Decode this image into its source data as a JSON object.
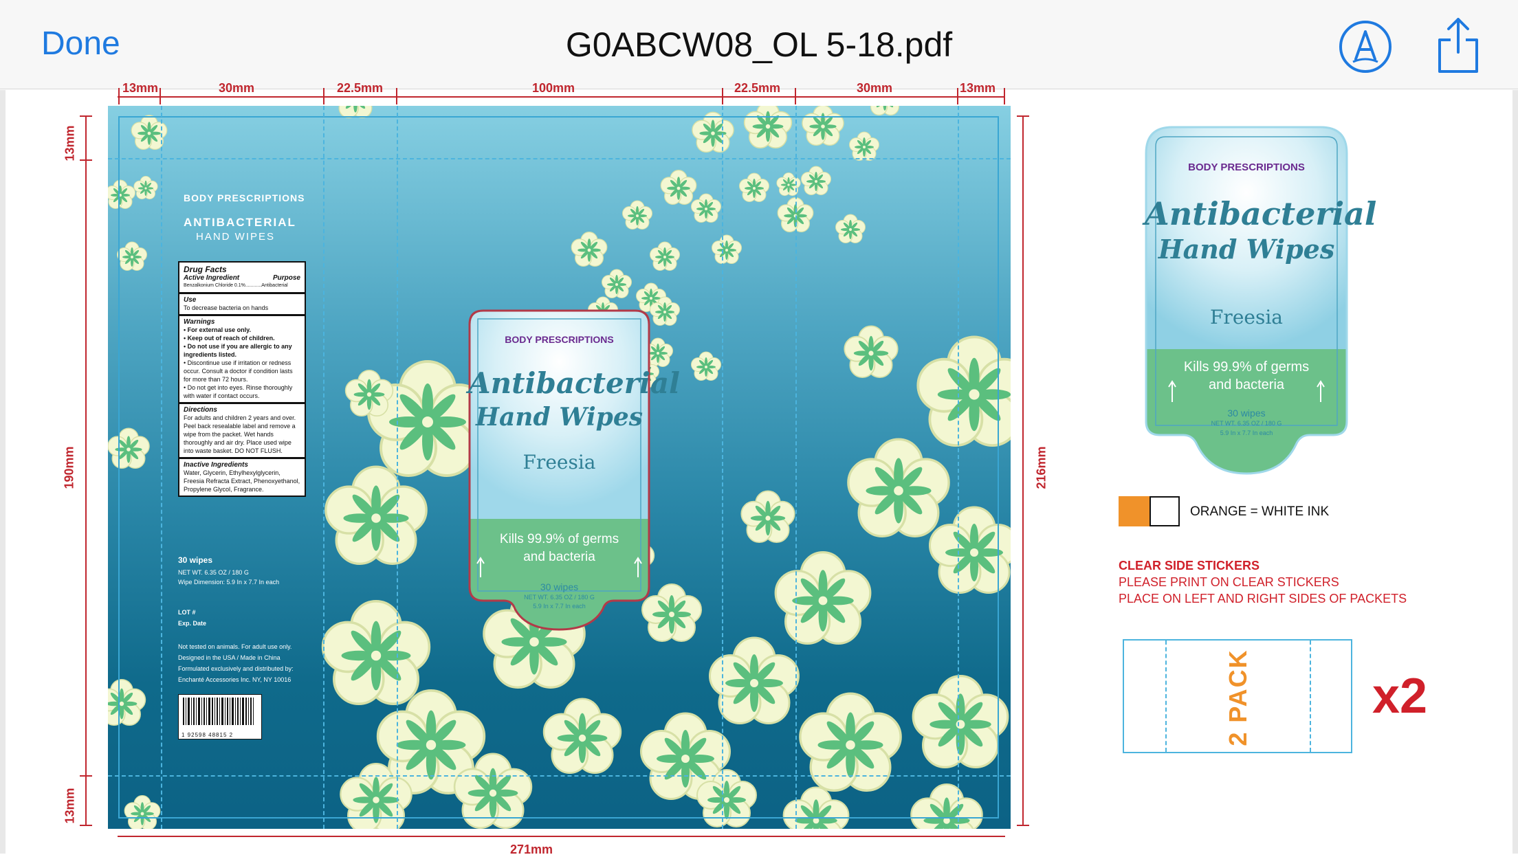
{
  "navbar": {
    "done_label": "Done",
    "title": "G0ABCW08_OL 5-18.pdf",
    "markup_icon": "markup-pen-icon",
    "share_icon": "share-icon"
  },
  "dimensions": {
    "top": [
      "13mm",
      "30mm",
      "22.5mm",
      "100mm",
      "22.5mm",
      "30mm",
      "13mm"
    ],
    "bottom": "271mm",
    "left": [
      "13mm",
      "190mm",
      "13mm"
    ],
    "right": "216mm"
  },
  "side_panel": {
    "brand": "BODY PRESCRIPTIONS",
    "product_line1": "ANTIBACTERIAL",
    "product_line2": "HAND WIPES",
    "drug_facts": {
      "title": "Drug Facts",
      "active_header": "Active Ingredient",
      "purpose_header": "Purpose",
      "active_row": "Benzalkonium Chloride 0.1%............Antibacterial",
      "use_title": "Use",
      "use_text": "To decrease bacteria on hands",
      "warnings_title": "Warnings",
      "warnings": [
        "• For external use only.",
        "• Keep out of reach of children.",
        "• Do not use if you are allergic to any ingredients listed.",
        "• Discontinue use if irritation or redness occur. Consult a doctor if condition lasts for more than 72 hours.",
        "• Do not get into eyes. Rinse thoroughly with water if contact occurs."
      ],
      "directions_title": "Directions",
      "directions_text": "For adults and children 2 years and over. Peel back resealable label and remove a wipe from the packet. Wet hands thoroughly and air dry. Place used wipe into waste basket. DO NOT FLUSH.",
      "inactive_title": "Inactive Ingredients",
      "inactive_text": "Water, Glycerin, Ethylhexylglycerin, Freesia Refracta Extract, Phenoxyethanol, Propylene Glycol, Fragrance."
    },
    "wipes_count": "30 wipes",
    "net_wt": "NET WT. 6.35 OZ / 180 G",
    "wipe_dim": "Wipe Dimension: 5.9 In x 7.7 In each",
    "lot": "LOT #",
    "exp": "Exp. Date",
    "legal1": "Not tested on animals. For adult use only.",
    "legal2": "Designed in the USA / Made in China",
    "legal3": "Formulated exclusively and distributed by:",
    "legal4": "Enchanté Accessories Inc. NY, NY 10016",
    "barcode_number": "1 92598 48815 2"
  },
  "label": {
    "brand": "BODY PRESCRIPTIONS",
    "script1": "Antibacterial",
    "script2": "Hand Wipes",
    "scent": "Freesia",
    "kills1": "Kills 99.9% of germs",
    "kills2": "and bacteria",
    "wipes": "30 wipes",
    "net": "NET WT. 6.35 OZ / 180 G",
    "size": "5.9 In x 7.7 In each"
  },
  "legend": {
    "text": "ORANGE = WHITE INK",
    "orange": "#f0922a"
  },
  "stickers": {
    "title": "CLEAR SIDE STICKERS",
    "line1": "PLEASE PRINT ON CLEAR STICKERS",
    "line2": "PLACE ON LEFT AND RIGHT SIDES OF PACKETS",
    "pack_text": "2 PACK",
    "multiplier": "x2"
  }
}
